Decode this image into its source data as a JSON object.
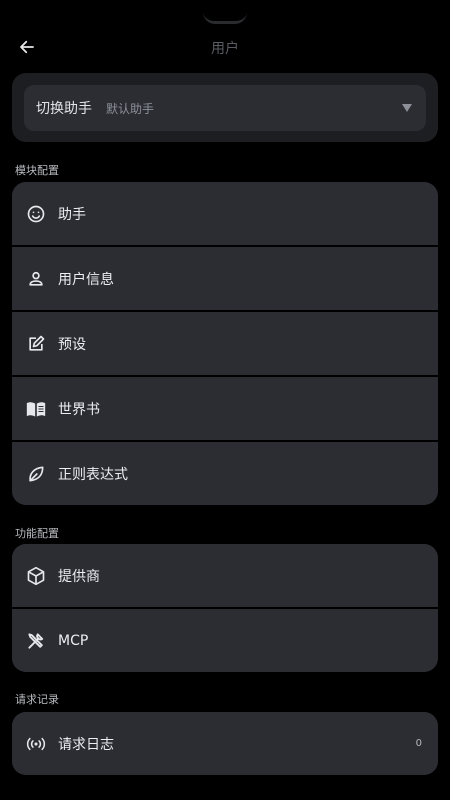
{
  "header": {
    "title": "用户"
  },
  "assistant_switch": {
    "label": "切换助手",
    "value": "默认助手"
  },
  "sections": {
    "modules": {
      "title": "模块配置",
      "items": [
        {
          "label": "助手",
          "icon": "smiley-icon"
        },
        {
          "label": "用户信息",
          "icon": "person-icon"
        },
        {
          "label": "预设",
          "icon": "edit-note-icon"
        },
        {
          "label": "世界书",
          "icon": "book-icon"
        },
        {
          "label": "正则表达式",
          "icon": "leaf-icon"
        }
      ]
    },
    "features": {
      "title": "功能配置",
      "items": [
        {
          "label": "提供商",
          "icon": "cube-icon"
        },
        {
          "label": "MCP",
          "icon": "tools-icon"
        }
      ]
    },
    "records": {
      "title": "请求记录",
      "items": [
        {
          "label": "请求日志",
          "icon": "broadcast-icon",
          "count": "0"
        }
      ]
    }
  },
  "colors": {
    "background": "#000000",
    "card": "#2b2d33",
    "outer_card": "#1d1e22",
    "text": "#eceef2",
    "muted": "#8d9098"
  }
}
